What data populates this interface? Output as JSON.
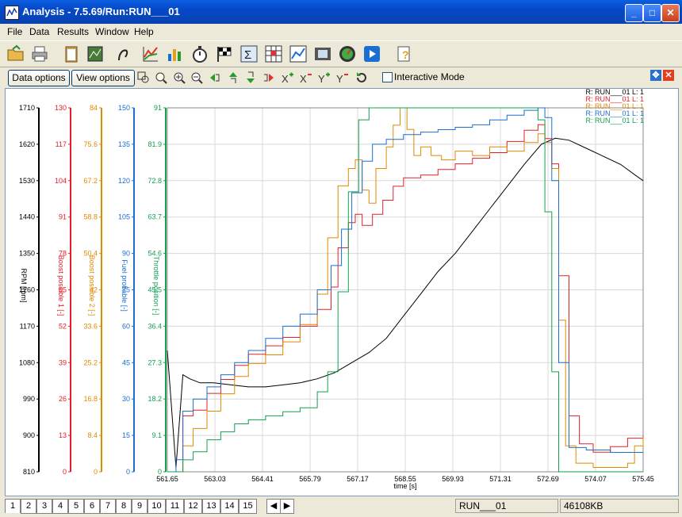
{
  "window": {
    "title": "Analysis - 7.5.69/Run:RUN___01"
  },
  "menu": [
    "File",
    "Data",
    "Results",
    "Window",
    "Help"
  ],
  "toolbar2": {
    "data_options": "Data options",
    "view_options": "View options",
    "interactive_mode": "Interactive Mode"
  },
  "legend": [
    "R: RUN___01  L: 1",
    "R: RUN___01  L: 1",
    "R: RUN___01  L: 1",
    "R: RUN___01  L: 1",
    "R: RUN___01  L: 1"
  ],
  "status": {
    "tabs": [
      "1",
      "2",
      "3",
      "4",
      "5",
      "6",
      "7",
      "8",
      "9",
      "10",
      "11",
      "12",
      "13",
      "14",
      "15"
    ],
    "run": "RUN___01",
    "memory": "46108KB"
  },
  "colors": {
    "rpm": "#000000",
    "boost1": "#e0202a",
    "boost2": "#e08a00",
    "fuel": "#1a6fd0",
    "throttle": "#13a050"
  },
  "chart_data": {
    "type": "line",
    "xlabel": "time [s]",
    "x_ticks": [
      "561.65",
      "563.03",
      "564.41",
      "565.79",
      "567.17",
      "568.55",
      "569.93",
      "571.31",
      "572.69",
      "574.07",
      "575.45"
    ],
    "xlim": [
      561.65,
      575.45
    ],
    "axes": [
      {
        "label": "RPM [rpm]",
        "ticks": [
          "810",
          "900",
          "990",
          "1080",
          "1170",
          "1260",
          "1350",
          "1440",
          "1530",
          "1620",
          "1710"
        ],
        "range": [
          810,
          1710
        ]
      },
      {
        "label": "Boost possible 1 [-]",
        "ticks": [
          "0",
          "13",
          "26",
          "39",
          "52",
          "65",
          "78",
          "91",
          "104",
          "117",
          "130"
        ],
        "range": [
          0,
          130
        ]
      },
      {
        "label": "Boost possible 2 [-]",
        "ticks": [
          "0",
          "8.4",
          "16.8",
          "25.2",
          "33.6",
          "42",
          "50.4",
          "58.8",
          "67.2",
          "75.6",
          "84"
        ],
        "range": [
          0,
          84
        ]
      },
      {
        "label": "Fuel probable [-]",
        "ticks": [
          "0",
          "15",
          "30",
          "45",
          "60",
          "75",
          "90",
          "105",
          "120",
          "135",
          "150"
        ],
        "range": [
          0,
          150
        ]
      },
      {
        "label": "Throttle position [-]",
        "ticks": [
          "0",
          "9.1",
          "18.2",
          "27.3",
          "36.4",
          "45.5",
          "54.6",
          "63.7",
          "72.8",
          "81.9",
          "91"
        ],
        "range": [
          0,
          91
        ]
      }
    ],
    "series": [
      {
        "name": "R: RUN___01  L: 1",
        "axis": 0,
        "x": [
          561.65,
          561.9,
          562.1,
          562.3,
          562.6,
          563.0,
          563.5,
          564.0,
          564.5,
          565.0,
          565.5,
          566.0,
          566.5,
          567.0,
          567.5,
          568.0,
          568.5,
          569.0,
          569.5,
          570.0,
          570.5,
          571.0,
          571.5,
          572.0,
          572.5,
          572.9,
          573.3,
          573.8,
          574.3,
          574.8,
          575.2,
          575.45
        ],
        "y": [
          1110,
          820,
          1050,
          1040,
          1030,
          1030,
          1025,
          1020,
          1020,
          1025,
          1030,
          1040,
          1055,
          1080,
          1105,
          1140,
          1195,
          1250,
          1305,
          1350,
          1405,
          1460,
          1515,
          1570,
          1620,
          1635,
          1630,
          1610,
          1590,
          1570,
          1545,
          1530
        ]
      },
      {
        "name": "R: RUN___01  L: 1",
        "axis": 1,
        "x": [
          561.65,
          561.9,
          562.1,
          562.4,
          562.8,
          563.2,
          563.6,
          564.0,
          564.5,
          565.0,
          565.5,
          566.0,
          566.4,
          566.6,
          566.9,
          567.1,
          567.3,
          567.6,
          567.9,
          568.2,
          568.5,
          569.0,
          569.5,
          570.0,
          570.5,
          571.0,
          571.5,
          572.0,
          572.4,
          572.6,
          572.8,
          573.0,
          573.3,
          573.6,
          574.0,
          574.5,
          575.0,
          575.45
        ],
        "y": [
          0,
          0,
          20,
          22,
          28,
          33,
          38,
          42,
          45,
          48,
          52,
          58,
          66,
          80,
          89,
          92,
          88,
          92,
          97,
          102,
          105,
          106,
          108,
          110,
          112,
          114,
          118,
          122,
          124,
          119,
          110,
          70,
          20,
          10,
          7,
          9,
          12,
          13
        ]
      },
      {
        "name": "R: RUN___01  L: 1",
        "axis": 2,
        "x": [
          561.65,
          561.9,
          562.1,
          562.4,
          562.8,
          563.2,
          563.6,
          564.0,
          564.5,
          565.0,
          565.5,
          566.0,
          566.3,
          566.6,
          566.9,
          567.1,
          567.3,
          567.5,
          567.7,
          568.0,
          568.2,
          568.4,
          568.6,
          568.8,
          569.0,
          569.3,
          569.6,
          570.0,
          570.5,
          571.0,
          571.5,
          572.0,
          572.4,
          572.6,
          572.8,
          573.0,
          573.2,
          573.5,
          574.0,
          574.5,
          575.0,
          575.2,
          575.45
        ],
        "y": [
          0,
          0,
          6,
          10,
          14,
          18,
          22,
          25,
          27,
          30,
          34,
          41,
          54,
          66,
          70,
          72,
          65,
          62,
          70,
          75,
          80,
          84,
          79,
          73,
          75,
          73,
          72,
          74,
          73,
          75,
          74,
          76,
          78,
          76,
          70,
          35,
          6,
          2,
          1,
          1,
          2,
          6,
          8
        ]
      },
      {
        "name": "R: RUN___01  L: 1",
        "axis": 3,
        "x": [
          561.65,
          561.9,
          562.1,
          562.4,
          562.8,
          563.2,
          563.6,
          564.0,
          564.5,
          565.0,
          565.5,
          566.0,
          566.4,
          566.7,
          567.0,
          567.3,
          567.6,
          568.0,
          568.5,
          569.0,
          569.5,
          570.0,
          570.5,
          571.0,
          571.5,
          572.0,
          572.4,
          572.6,
          572.8,
          573.0,
          573.3,
          573.8,
          574.5,
          575.45
        ],
        "y": [
          0,
          5,
          25,
          30,
          35,
          40,
          45,
          50,
          55,
          60,
          65,
          75,
          85,
          100,
          115,
          128,
          135,
          137,
          139,
          140,
          141,
          142,
          143,
          145,
          147,
          149,
          150,
          146,
          120,
          45,
          10,
          9,
          8,
          8
        ]
      },
      {
        "name": "R: RUN___01  L: 1",
        "axis": 4,
        "x": [
          561.65,
          561.9,
          562.1,
          562.4,
          562.8,
          563.2,
          563.6,
          564.0,
          564.5,
          565.0,
          565.5,
          566.0,
          566.3,
          566.6,
          566.9,
          567.2,
          567.5,
          568.0,
          568.5,
          569.0,
          569.5,
          570.0,
          570.5,
          571.0,
          571.5,
          572.0,
          572.4,
          572.6,
          572.8,
          573.0,
          573.2,
          574.0,
          575.45
        ],
        "y": [
          0,
          0,
          3,
          5,
          8,
          10,
          12,
          13,
          14,
          15,
          16,
          20,
          25,
          45,
          70,
          88,
          91,
          91,
          91,
          91,
          91,
          91,
          91,
          91,
          91,
          91,
          88,
          65,
          25,
          0,
          0,
          0,
          0
        ]
      }
    ]
  }
}
